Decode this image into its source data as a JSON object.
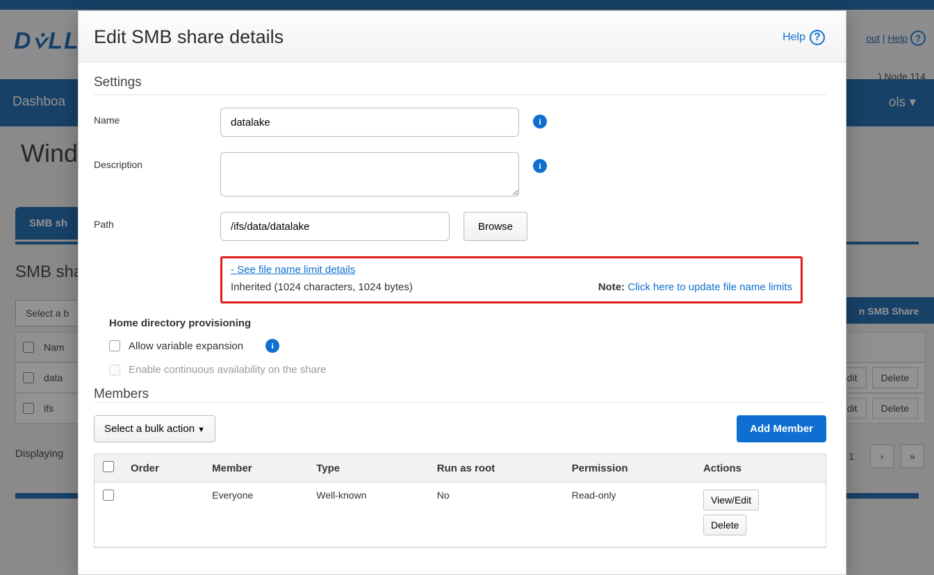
{
  "backdrop": {
    "logo": "D⩒LL",
    "logout": "out",
    "help": "Help",
    "node_info": ") Node 114",
    "nav_left": "Dashboa",
    "nav_right": "ols",
    "page_title_fragment": "Wind",
    "tab_fragment": "SMB sh",
    "section_title_fragment": "SMB sha",
    "bulk_btn_fragment": "Select a b",
    "create_btn_fragment": "n SMB Share",
    "thead": "Nam",
    "row1": "data",
    "row2": "ifs",
    "edit_fragment": "dit",
    "delete": "Delete",
    "footer_fragment": "Displaying",
    "pager_cur": "1"
  },
  "modal": {
    "title": "Edit SMB share details",
    "help": "Help",
    "settings_head": "Settings",
    "form": {
      "name_label": "Name",
      "name_value": "datalake",
      "desc_label": "Description",
      "desc_value": "",
      "path_label": "Path",
      "path_value": "/ifs/data/datalake",
      "browse": "Browse"
    },
    "callout": {
      "see_details": "- See file name limit details",
      "inherited": "Inherited (1024 characters, 1024 bytes)",
      "note_label": "Note:",
      "note_link": "Click here to update file name limits"
    },
    "provisioning": {
      "heading": "Home directory provisioning",
      "allow_var": "Allow variable expansion",
      "enable_ca": "Enable continuous availability on the share"
    },
    "members": {
      "heading": "Members",
      "bulk": "Select a bulk action",
      "add": "Add Member",
      "columns": {
        "order": "Order",
        "member": "Member",
        "type": "Type",
        "runasroot": "Run as root",
        "permission": "Permission",
        "actions": "Actions"
      },
      "rows": [
        {
          "order": "",
          "member": "Everyone",
          "type": "Well-known",
          "runasroot": "No",
          "permission": "Read-only",
          "view_edit": "View/Edit",
          "delete": "Delete"
        }
      ]
    }
  }
}
